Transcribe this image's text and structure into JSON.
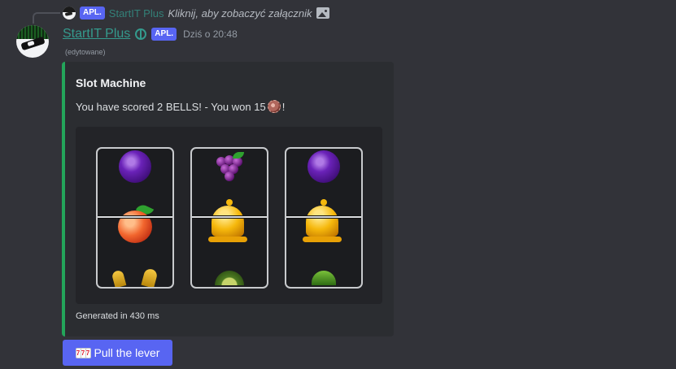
{
  "reply": {
    "app_tag": "APL.",
    "author": "StartIT Plus",
    "text": "Kliknij, aby zobaczyć załącznik"
  },
  "message": {
    "author": "StartIT Plus",
    "app_tag": "APL.",
    "timestamp": "Dziś o 20:48",
    "edited_label": "(edytowane)",
    "author_color": "#349a8d"
  },
  "embed": {
    "accent_color": "#23a55a",
    "title": "Slot Machine",
    "description": "You have scored 2 BELLS! - You won 15",
    "description_suffix": "!",
    "footer": "Generated in 430 ms",
    "reels": [
      {
        "top": "plum",
        "middle": "peach",
        "bottom": "banana"
      },
      {
        "top": "grapes",
        "middle": "bell",
        "bottom": "avocado"
      },
      {
        "top": "plum",
        "middle": "bell",
        "bottom": "pear"
      }
    ]
  },
  "button": {
    "icon": "slot-machine-icon",
    "label": "Pull the lever",
    "color": "#5865f2"
  }
}
